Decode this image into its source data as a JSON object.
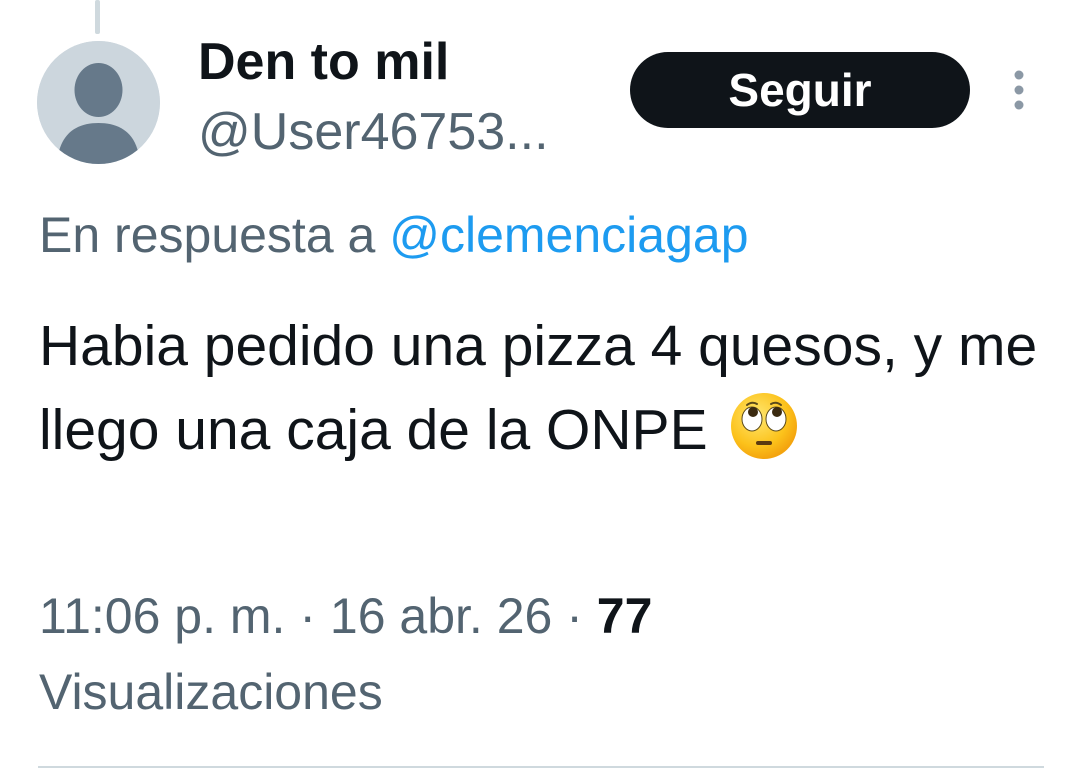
{
  "author": {
    "display_name": "Den to mil",
    "handle": "@User46753..."
  },
  "follow_button": {
    "label": "Seguir"
  },
  "more_button": {
    "icon": "more-vertical-icon"
  },
  "reply_context": {
    "prefix": "En respuesta a",
    "mention": "@clemenciagap"
  },
  "tweet": {
    "text": "Habia pedido una pizza 4 quesos, y me llego una caja de la ONPE",
    "emoji": "face-with-rolling-eyes"
  },
  "meta": {
    "time": "11:06 p. m.",
    "separator": "·",
    "date": "16 abr. 26",
    "views_count": "77",
    "views_label": "Visualizaciones"
  },
  "colors": {
    "text_primary": "#0f1419",
    "text_secondary": "#536471",
    "link": "#1d9bf0",
    "button_bg": "#0f1419",
    "avatar_bg": "#ccd6dd",
    "avatar_fg": "#66798a"
  }
}
